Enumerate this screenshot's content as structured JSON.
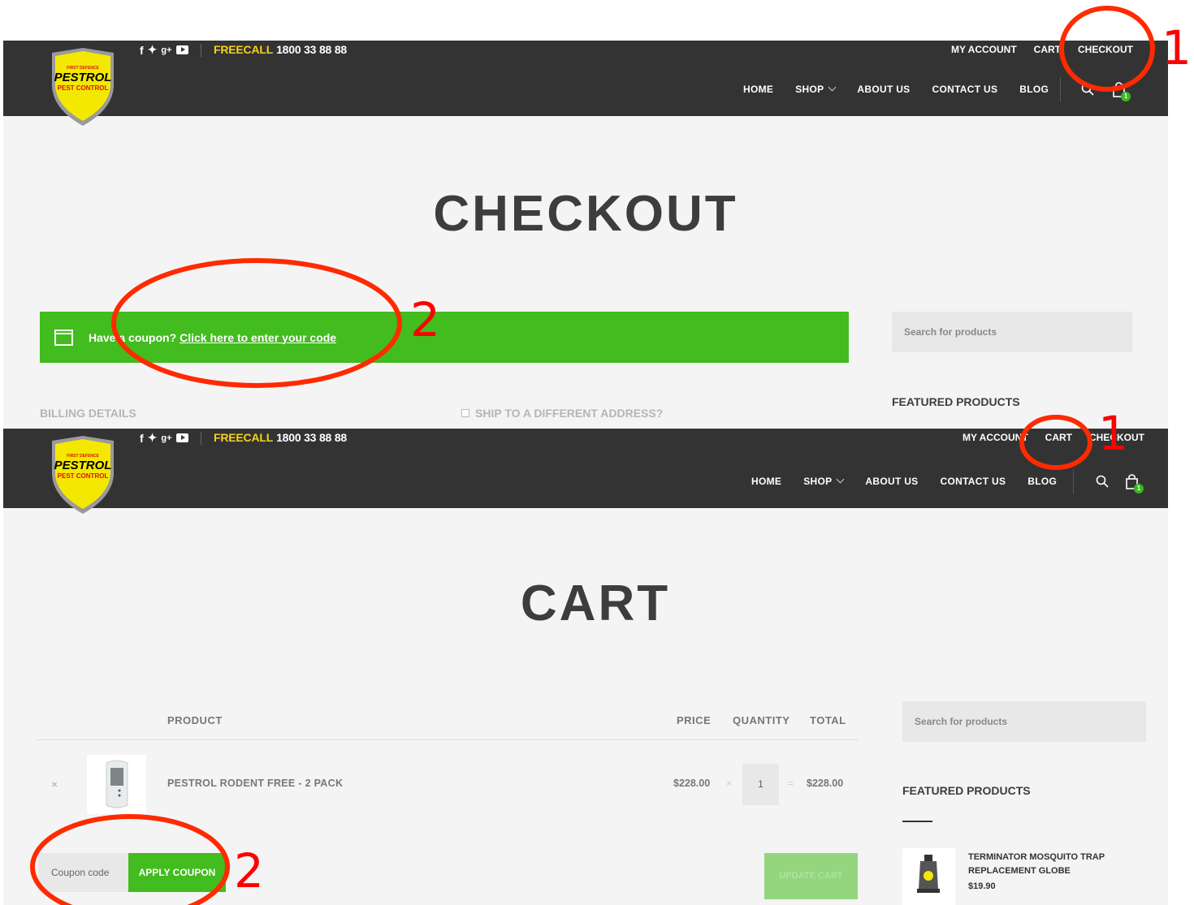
{
  "header": {
    "logo": {
      "small": "FIRST DEFENCE",
      "brand": "PESTROL",
      "sub": "PEST CONTROL"
    },
    "social": [
      "f",
      "🐦",
      "g+",
      "youtube"
    ],
    "freecall_label": "FREECALL",
    "freecall_number": "1800 33 88 88",
    "toplinks": [
      "MY ACCOUNT",
      "CART",
      "CHECKOUT"
    ],
    "nav": [
      "HOME",
      "SHOP",
      "ABOUT US",
      "CONTACT US",
      "BLOG"
    ],
    "cart_count": "1"
  },
  "checkout": {
    "title": "CHECKOUT",
    "notice_text": "Have a coupon?",
    "notice_link": "Click here to enter your code",
    "billing": "BILLING DETAILS",
    "shipto": "SHIP TO A DIFFERENT ADDRESS?",
    "search_placeholder": "Search for products",
    "featured": "FEATURED PRODUCTS"
  },
  "cart": {
    "title": "CART",
    "columns": [
      "PRODUCT",
      "PRICE",
      "QUANTITY",
      "TOTAL"
    ],
    "row": {
      "remove": "×",
      "product": "PESTROL RODENT FREE - 2 PACK",
      "price": "$228.00",
      "times": "×",
      "qty": "1",
      "equals": "=",
      "total": "$228.00"
    },
    "coupon_placeholder": "Coupon code",
    "apply": "APPLY COUPON",
    "update": "UPDATE CART",
    "search_placeholder": "Search for products",
    "featured": "FEATURED PRODUCTS",
    "featured_item": {
      "name": "TERMINATOR MOSQUITO TRAP REPLACEMENT GLOBE",
      "price": "$19.90"
    }
  },
  "annotations": [
    "1",
    "2",
    "1",
    "2"
  ],
  "colors": {
    "header": "#333333",
    "accent_green": "#42bc1e",
    "freecall": "#f3d21a",
    "annotation": "#ff0000"
  }
}
